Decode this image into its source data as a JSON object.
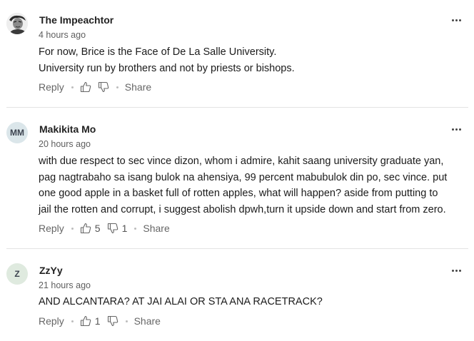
{
  "colors": {
    "avatar_mm_bg": "#dbe6ea",
    "avatar_z_bg": "#dfeadf",
    "divider": "#e3e3e3",
    "meta_text": "#666666"
  },
  "labels": {
    "reply": "Reply",
    "share": "Share"
  },
  "icons": {
    "more": "more-horizontal-icon",
    "like": "thumbs-up-icon",
    "dislike": "thumbs-down-icon",
    "avatar_photo": "user-photo-avatar"
  },
  "comments": [
    {
      "author": "The Impeachtor",
      "avatar_text": "",
      "time": "4 hours ago",
      "lines": [
        "For now, Brice is the Face of De La Salle University.",
        "University run by brothers and not by priests or bishops."
      ],
      "likes": "",
      "dislikes": ""
    },
    {
      "author": "Makikita Mo",
      "avatar_text": "MM",
      "time": "20 hours ago",
      "lines": [
        "with due respect to sec vince dizon, whom i admire, kahit saang university graduate yan,",
        "pag nagtrabaho sa isang bulok na ahensiya, 99 percent mabubulok din po, sec vince. put",
        "one good apple in a basket full of rotten apples, what will happen? aside from putting to",
        "jail the rotten and corrupt,  i suggest abolish dpwh,turn it upside down and start from zero."
      ],
      "likes": "5",
      "dislikes": "1"
    },
    {
      "author": "ZzYy",
      "avatar_text": "Z",
      "time": "21 hours ago",
      "lines": [
        "AND ALCANTARA? AT JAI ALAI OR STA ANA RACETRACK?"
      ],
      "likes": "1",
      "dislikes": ""
    }
  ]
}
